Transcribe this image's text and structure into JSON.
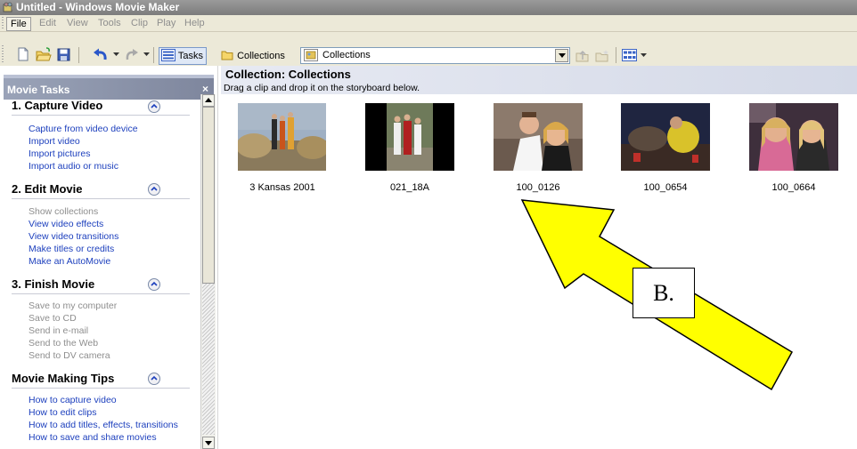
{
  "window": {
    "title": "Untitled - Windows Movie Maker"
  },
  "menu": [
    "File",
    "Edit",
    "View",
    "Tools",
    "Clip",
    "Play",
    "Help"
  ],
  "toolbar": {
    "tasks_label": "Tasks",
    "collections_label": "Collections",
    "collection_combo_value": "Collections"
  },
  "tasks_pane": {
    "title": "Movie Tasks",
    "close": "×",
    "sections": [
      {
        "title": "1. Capture Video",
        "items": [
          {
            "label": "Capture from video device",
            "enabled": true
          },
          {
            "label": "Import video",
            "enabled": true
          },
          {
            "label": "Import pictures",
            "enabled": true
          },
          {
            "label": "Import audio or music",
            "enabled": true
          }
        ]
      },
      {
        "title": "2. Edit Movie",
        "items": [
          {
            "label": "Show collections",
            "enabled": false
          },
          {
            "label": "View video effects",
            "enabled": true
          },
          {
            "label": "View video transitions",
            "enabled": true
          },
          {
            "label": "Make titles or credits",
            "enabled": true
          },
          {
            "label": "Make an AutoMovie",
            "enabled": true
          }
        ]
      },
      {
        "title": "3. Finish Movie",
        "items": [
          {
            "label": "Save to my computer",
            "enabled": false
          },
          {
            "label": "Save to CD",
            "enabled": false
          },
          {
            "label": "Send in e-mail",
            "enabled": false
          },
          {
            "label": "Send to the Web",
            "enabled": false
          },
          {
            "label": "Send to DV camera",
            "enabled": false
          }
        ]
      },
      {
        "title": "Movie Making Tips",
        "items": [
          {
            "label": "How to capture video",
            "enabled": true
          },
          {
            "label": "How to edit clips",
            "enabled": true
          },
          {
            "label": "How to add titles, effects, transitions",
            "enabled": true
          },
          {
            "label": "How to save and share movies",
            "enabled": true
          }
        ]
      }
    ]
  },
  "collection": {
    "title": "Collection: Collections",
    "subtitle": "Drag a clip and drop it on the storyboard below.",
    "clips": [
      {
        "name": "3 Kansas 2001"
      },
      {
        "name": "021_18A"
      },
      {
        "name": "100_0126"
      },
      {
        "name": "100_0654"
      },
      {
        "name": "100_0664"
      }
    ]
  },
  "annotation": {
    "label": "B.",
    "arrow_color": "#ffff00"
  },
  "colors": {
    "link": "#1c3fbd",
    "disabled": "#8e8e8e",
    "titlebar": "#8a8a8a"
  },
  "icons": [
    "app-icon",
    "new-project-icon",
    "open-project-icon",
    "save-icon",
    "undo-icon",
    "redo-icon",
    "tasks-icon",
    "collections-folder-icon",
    "up-one-level-icon",
    "new-collection-folder-icon",
    "views-icon",
    "collapse-chevron-icon"
  ]
}
